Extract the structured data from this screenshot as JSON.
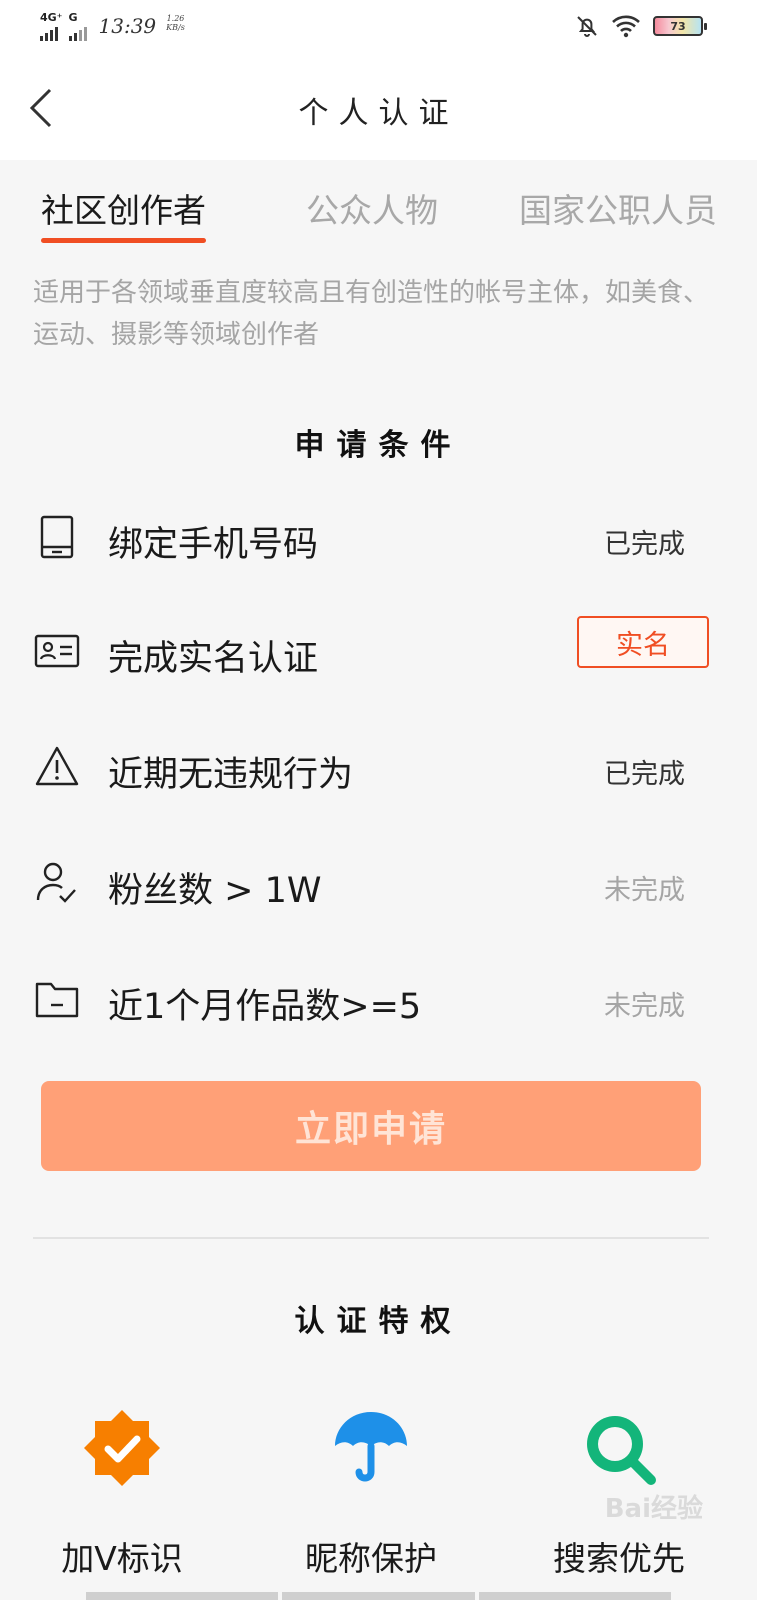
{
  "status_bar": {
    "network1": "4G⁺",
    "network2": "G",
    "time": "13:39",
    "speed_value": "1.26",
    "speed_unit": "KB/s",
    "battery": "73"
  },
  "header": {
    "title": "个人认证"
  },
  "tabs": [
    {
      "label": "社区创作者",
      "active": true
    },
    {
      "label": "公众人物",
      "active": false
    },
    {
      "label": "国家公职人员",
      "active": false
    }
  ],
  "description": "适用于各领域垂直度较高且有创造性的帐号主体，如美食、运动、摄影等领域创作者",
  "requirements": {
    "title": "申请条件",
    "items": [
      {
        "icon": "phone-icon",
        "label": "绑定手机号码",
        "status": "已完成",
        "state": "done"
      },
      {
        "icon": "id-card-icon",
        "label": "完成实名认证",
        "status": "实名",
        "state": "action"
      },
      {
        "icon": "warning-icon",
        "label": "近期无违规行为",
        "status": "已完成",
        "state": "done"
      },
      {
        "icon": "user-check-icon",
        "label": "粉丝数 > 1W",
        "status": "未完成",
        "state": "todo"
      },
      {
        "icon": "folder-icon",
        "label": "近1个月作品数>=5",
        "status": "未完成",
        "state": "todo"
      }
    ]
  },
  "apply_button": "立即申请",
  "privileges": {
    "title": "认证特权",
    "items": [
      {
        "icon": "verified-badge-icon",
        "label": "加V标识"
      },
      {
        "icon": "umbrella-icon",
        "label": "昵称保护"
      },
      {
        "icon": "search-icon",
        "label": "搜索优先"
      }
    ]
  },
  "watermark": "Bai经验",
  "colors": {
    "accent": "#f04e23",
    "apply_button_bg": "#ffa077",
    "badge_orange": "#f77f00",
    "umbrella_blue": "#1e90e8",
    "search_green": "#13b57a"
  }
}
